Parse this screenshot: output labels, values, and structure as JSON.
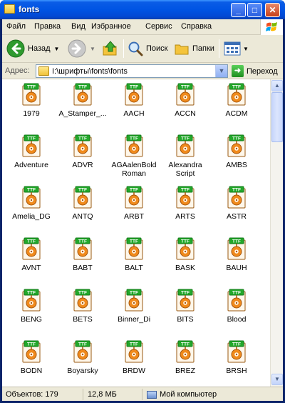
{
  "window": {
    "title": "fonts"
  },
  "menu": [
    "Файл",
    "Правка",
    "Вид",
    "Избранное",
    "Сервис",
    "Справка"
  ],
  "toolbar": {
    "back_label": "Назад",
    "search_label": "Поиск",
    "folders_label": "Папки"
  },
  "address": {
    "label": "Адрес:",
    "path": "I:\\шрифты\\fonts\\fonts",
    "go_label": "Переход"
  },
  "files": [
    "1979",
    "A_Stamper_...",
    "AACH",
    "ACCN",
    "ACDM",
    "Adventure",
    "ADVR",
    "AGAalenBold Roman",
    "Alexandra Script",
    "AMBS",
    "Amelia_DG",
    "ANTQ",
    "ARBT",
    "ARTS",
    "ASTR",
    "AVNT",
    "BABT",
    "BALT",
    "BASK",
    "BAUH",
    "BENG",
    "BETS",
    "Binner_Di",
    "BITS",
    "Blood",
    "BODN",
    "Boyarsky",
    "BRDW",
    "BREZ",
    "BRSH"
  ],
  "file_badge": "TTF",
  "status": {
    "count": "Объектов: 179",
    "size": "12,8 МБ",
    "location": "Мой компьютер"
  },
  "colors": {
    "titlebar": "#0054e3",
    "chrome": "#ece9d8",
    "badge": "#22a82a",
    "icon_accent": "#f08a1c"
  }
}
